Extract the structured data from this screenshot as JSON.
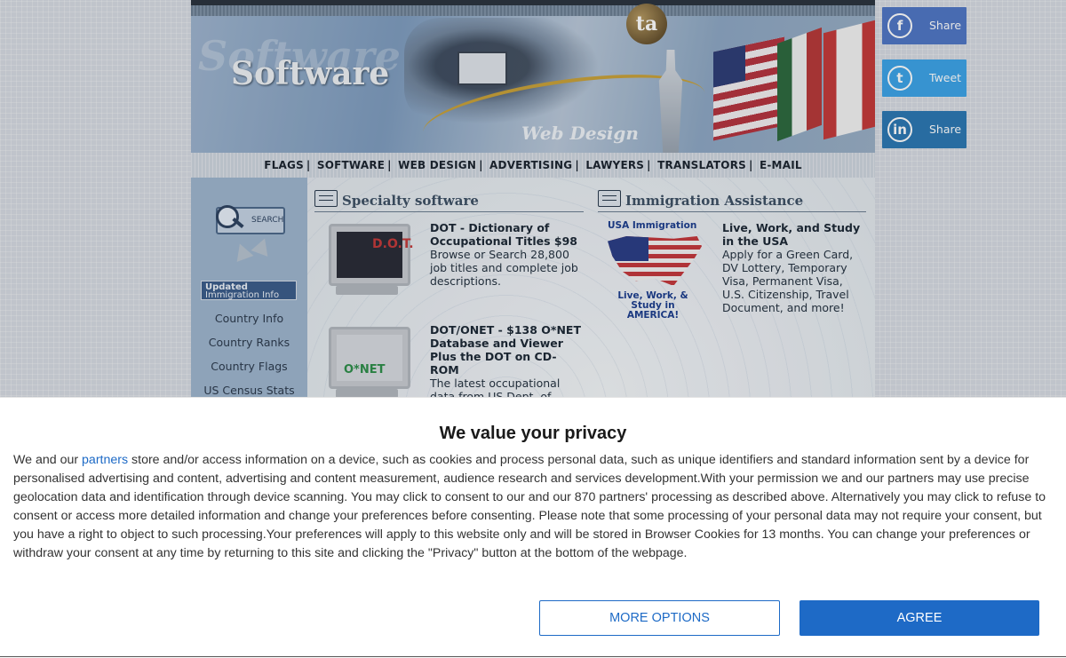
{
  "banner": {
    "ghost_text": "Software",
    "title": "Software",
    "subtitle": "Web Design",
    "logo_text": "ta"
  },
  "topnav": [
    "FLAGS",
    "SOFTWARE",
    "WEB DESIGN",
    "ADVERTISING",
    "LAWYERS",
    "TRANSLATORS",
    "E-MAIL"
  ],
  "sidebar": {
    "search_label": "SEARCH",
    "updated_line1": "Updated",
    "updated_line2": "Immigration Info",
    "links": [
      "Country Info",
      "Country Ranks",
      "Country Flags",
      "US Census Stats"
    ]
  },
  "specialty": {
    "heading": "Specialty software",
    "items": [
      {
        "title": "DOT - Dictionary of Occupational Titles $98",
        "desc": "Browse or Search 28,800 job titles and complete job descriptions.",
        "screen_label": "D.O.T."
      },
      {
        "title": "DOT/ONET - $138 O*NET Database and Viewer Plus the DOT on CD-ROM",
        "desc": "The latest occupational data from US Dept. of Labor",
        "screen_label": "O*NET"
      }
    ]
  },
  "immigration": {
    "heading": "Immigration Assistance",
    "map_top": "USA Immigration",
    "map_bottom": "Live, Work, & Study in AMERICA!",
    "title": "Live, Work, and Study in the USA",
    "desc": "Apply for a Green Card, DV Lottery, Temporary Visa, Permanent Visa, U.S. Citizenship, Travel Document, and more!"
  },
  "social": {
    "facebook": "Share",
    "twitter": "Tweet",
    "linkedin": "Share"
  },
  "consent": {
    "title": "We value your privacy",
    "lead": "We and our",
    "partners_link": "partners",
    "body": " store and/or access information on a device, such as cookies and process personal data, such as unique identifiers and standard information sent by a device for personalised advertising and content, advertising and content measurement, audience research and services development.With your permission we and our partners may use precise geolocation data and identification through device scanning. You may click to consent to our and our 870 partners' processing as described above. Alternatively you may click to refuse to consent or access more detailed information and change your preferences before consenting. Please note that some processing of your personal data may not require your consent, but you have a right to object to such processing.Your preferences will apply to this website only and will be stored in Browser Cookies for 13 months. You can change your preferences or withdraw your consent at any time by returning to this site and clicking the \"Privacy\" button at the bottom of the webpage.",
    "more_options": "MORE OPTIONS",
    "agree": "AGREE"
  }
}
